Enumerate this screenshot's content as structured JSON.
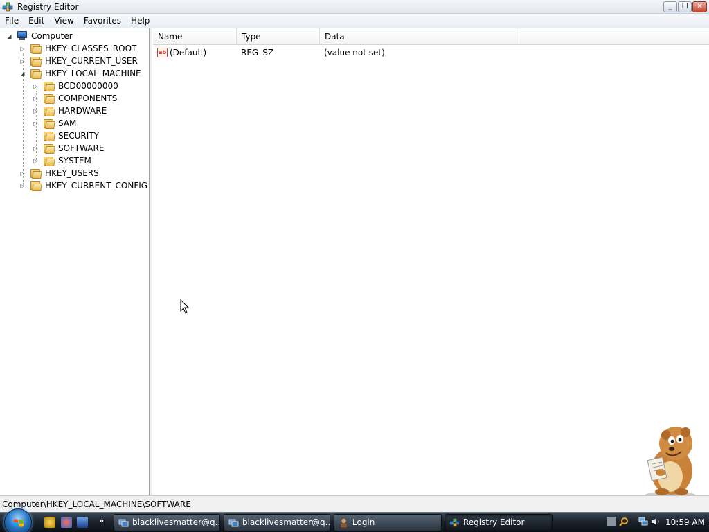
{
  "window": {
    "title": "Registry Editor"
  },
  "menu": {
    "items": [
      "File",
      "Edit",
      "View",
      "Favorites",
      "Help"
    ]
  },
  "tree": {
    "root": "Computer",
    "hives": [
      {
        "label": "HKEY_CLASSES_ROOT",
        "expanded": false
      },
      {
        "label": "HKEY_CURRENT_USER",
        "expanded": false
      },
      {
        "label": "HKEY_LOCAL_MACHINE",
        "expanded": true
      },
      {
        "label": "HKEY_USERS",
        "expanded": false
      },
      {
        "label": "HKEY_CURRENT_CONFIG",
        "expanded": false
      }
    ],
    "hklm_children": [
      {
        "label": "BCD00000000",
        "has_children": true
      },
      {
        "label": "COMPONENTS",
        "has_children": true
      },
      {
        "label": "HARDWARE",
        "has_children": true
      },
      {
        "label": "SAM",
        "has_children": true
      },
      {
        "label": "SECURITY",
        "has_children": false
      },
      {
        "label": "SOFTWARE",
        "has_children": true
      },
      {
        "label": "SYSTEM",
        "has_children": true
      }
    ]
  },
  "list": {
    "columns": [
      "Name",
      "Type",
      "Data"
    ],
    "rows": [
      {
        "name": "(Default)",
        "type": "REG_SZ",
        "data": "(value not set)",
        "icon": "string-value-icon"
      }
    ]
  },
  "status_bar": {
    "path": "Computer\\HKEY_LOCAL_MACHINE\\SOFTWARE"
  },
  "taskbar": {
    "tasks": [
      {
        "label": "blacklivesmatter@q...",
        "icon": "network-icon",
        "active": false
      },
      {
        "label": "blacklivesmatter@q...",
        "icon": "network-icon",
        "active": false
      },
      {
        "label": "Login",
        "icon": "user-icon",
        "active": false
      },
      {
        "label": "Registry Editor",
        "icon": "regedit-icon",
        "active": true
      }
    ],
    "quick_launch_more": "»",
    "clock": "10:59 AM"
  },
  "colors": {
    "taskbar": "#1b232c",
    "selection": "#3399ff",
    "folder": "#e8bb4f"
  }
}
